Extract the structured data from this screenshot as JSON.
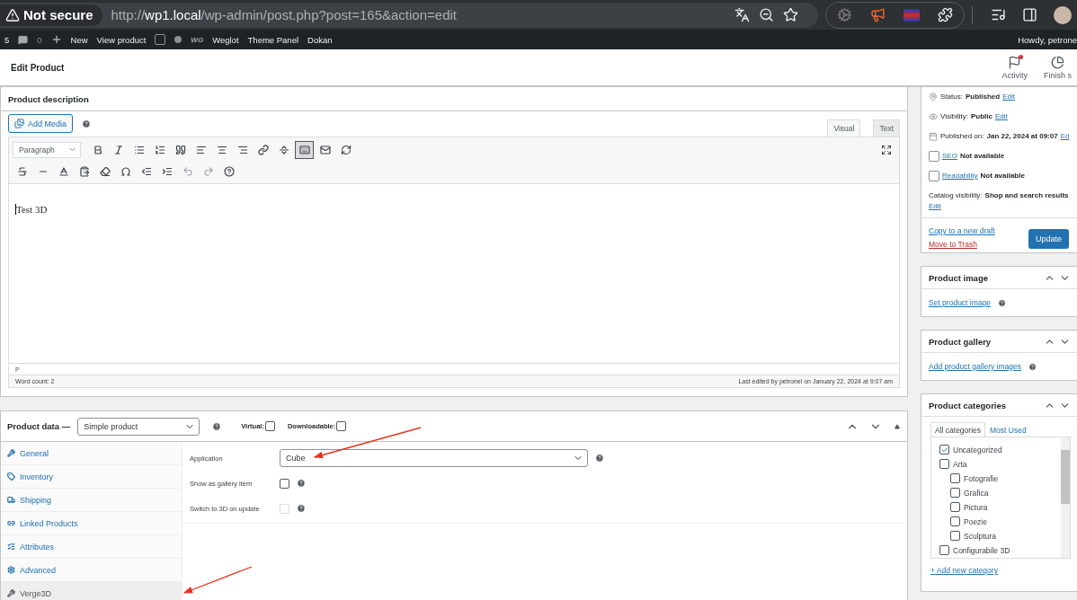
{
  "browser": {
    "security": "Not secure",
    "url": "http://**wp1.local**/wp-admin/post.php?post=165&action=edit"
  },
  "admin_bar": {
    "items": [
      {
        "kind": "count",
        "text": "5"
      },
      {
        "kind": "comments",
        "text": "0"
      },
      {
        "kind": "new",
        "text": "New"
      },
      {
        "kind": "link",
        "text": "View product"
      },
      {
        "kind": "yoast"
      },
      {
        "kind": "dot"
      },
      {
        "kind": "weglot",
        "logo": "WG",
        "text": "Weglot"
      },
      {
        "kind": "link",
        "text": "Theme Panel"
      },
      {
        "kind": "link",
        "text": "Dokan"
      }
    ],
    "greeting": "Howdy, petrone"
  },
  "header": {
    "title": "Edit Product",
    "actions": [
      {
        "kind": "flag",
        "label": "Activity",
        "badge": true
      },
      {
        "kind": "progress",
        "label": "Finish s",
        "badge": false
      }
    ]
  },
  "description": {
    "title": "Product description",
    "add_media": "Add Media",
    "tabs": [
      {
        "label": "Visual",
        "selected": true
      },
      {
        "label": "Text",
        "selected": false
      }
    ],
    "format": "Paragraph",
    "toolbar_rows": [
      [
        {
          "kind": "bold",
          "pressed": false,
          "disabled": false
        },
        {
          "kind": "italic",
          "pressed": false,
          "disabled": false
        },
        {
          "kind": "bullets",
          "pressed": false,
          "disabled": false
        },
        {
          "kind": "numbers",
          "pressed": false,
          "disabled": false
        },
        {
          "kind": "quote",
          "pressed": false,
          "disabled": false
        },
        {
          "kind": "align-left",
          "pressed": false,
          "disabled": false
        },
        {
          "kind": "align-center",
          "pressed": false,
          "disabled": false
        },
        {
          "kind": "align-right",
          "pressed": false,
          "disabled": false
        },
        {
          "kind": "link",
          "pressed": false,
          "disabled": false
        },
        {
          "kind": "read-more",
          "pressed": false,
          "disabled": false
        },
        {
          "kind": "keyboard",
          "pressed": true,
          "disabled": false
        },
        {
          "kind": "mail",
          "pressed": false,
          "disabled": false
        },
        {
          "kind": "refresh",
          "pressed": false,
          "disabled": false
        }
      ],
      [
        {
          "kind": "strike",
          "pressed": false,
          "disabled": false
        },
        {
          "kind": "hr",
          "pressed": false,
          "disabled": false
        },
        {
          "kind": "text-color",
          "pressed": false,
          "disabled": false
        },
        {
          "kind": "paste",
          "pressed": false,
          "disabled": false
        },
        {
          "kind": "eraser",
          "pressed": false,
          "disabled": false
        },
        {
          "kind": "omega",
          "pressed": false,
          "disabled": false
        },
        {
          "kind": "outdent",
          "pressed": false,
          "disabled": false
        },
        {
          "kind": "indent",
          "pressed": false,
          "disabled": false
        },
        {
          "kind": "undo",
          "pressed": false,
          "disabled": true
        },
        {
          "kind": "redo",
          "pressed": false,
          "disabled": true
        },
        {
          "kind": "help",
          "pressed": false,
          "disabled": false
        }
      ]
    ],
    "content": "Test 3D",
    "path": "P",
    "word_count": "Word count: 2",
    "last_edited": "Last edited by petronel on January 22, 2024 at 9:07 am"
  },
  "product_data": {
    "title": "Product data —",
    "type": "Simple product",
    "options": [
      {
        "label": "Virtual:",
        "checked": false
      },
      {
        "label": "Downloadable:",
        "checked": false
      }
    ],
    "tabs": [
      {
        "kind": "wrench",
        "label": "General",
        "selected": false
      },
      {
        "kind": "tag",
        "label": "Inventory",
        "selected": false
      },
      {
        "kind": "truck",
        "label": "Shipping",
        "selected": false
      },
      {
        "kind": "link",
        "label": "Linked Products",
        "selected": false
      },
      {
        "kind": "list",
        "label": "Attributes",
        "selected": false
      },
      {
        "kind": "gear",
        "label": "Advanced",
        "selected": false
      },
      {
        "kind": "wrench",
        "label": "Verge3D",
        "selected": true
      }
    ],
    "fields": [
      {
        "kind": "select",
        "label": "Application",
        "value": "Cube"
      },
      {
        "kind": "checkbox",
        "label": "Show as gallery item",
        "checked": false,
        "disabled": false
      },
      {
        "kind": "checkbox",
        "label": "Switch to 3D on update",
        "checked": false,
        "disabled": true
      }
    ]
  },
  "publish": {
    "rows": [
      {
        "kind": "pin",
        "label": "Status:",
        "value": "Published",
        "link": "Edit"
      },
      {
        "kind": "eye",
        "label": "Visibility:",
        "value": "Public",
        "link": "Edit"
      },
      {
        "kind": "calendar",
        "label": "Published on:",
        "value": "Jan 22, 2024 at 09:07",
        "link": "Ed"
      },
      {
        "kind": "yoast",
        "link": "SEO",
        "value": "Not available"
      },
      {
        "kind": "yoast",
        "link": "Readability",
        "value": "Not available"
      }
    ],
    "catalog": {
      "label": "Catalog visibility:",
      "value": "Shop and search results",
      "link": "Edit"
    },
    "copy": "Copy to a new draft",
    "trash": "Move to Trash",
    "update": "Update"
  },
  "product_image": {
    "title": "Product image",
    "link": "Set product image"
  },
  "product_gallery": {
    "title": "Product gallery",
    "link": "Add product gallery images"
  },
  "categories": {
    "title": "Product categories",
    "tabs": [
      {
        "label": "All categories",
        "selected": true
      },
      {
        "label": "Most Used",
        "selected": false
      }
    ],
    "items": [
      {
        "label": "Uncategorized",
        "checked": true
      },
      {
        "label": "Arta",
        "checked": false,
        "children": [
          {
            "label": "Fotografie",
            "checked": false
          },
          {
            "label": "Grafica",
            "checked": false
          },
          {
            "label": "Pictura",
            "checked": false
          },
          {
            "label": "Poezie",
            "checked": false
          },
          {
            "label": "Sculptura",
            "checked": false
          }
        ]
      },
      {
        "label": "Configurabile 3D",
        "checked": false
      }
    ],
    "add": "+ Add new category"
  },
  "annotations": [
    {
      "kind": "arrow"
    },
    {
      "kind": "arrow"
    }
  ]
}
